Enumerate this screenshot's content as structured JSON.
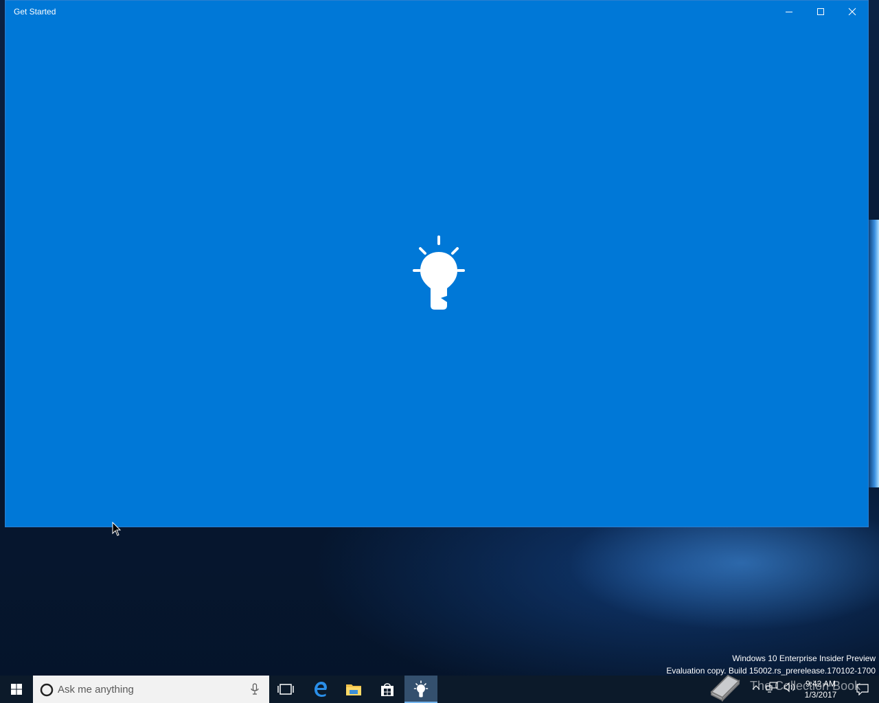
{
  "window": {
    "title": "Get Started",
    "background_color": "#0078d7",
    "splash_icon": "lightbulb-icon",
    "buttons": [
      "minimize-icon",
      "maximize-icon",
      "close-icon"
    ]
  },
  "watermark": {
    "line1": "Windows 10 Enterprise Insider Preview",
    "line2": "Evaluation copy. Build 15002.rs_prerelease.170102-1700"
  },
  "taskbar": {
    "search_placeholder": "Ask me anything",
    "pinned": [
      "task-view-icon",
      "edge-icon",
      "file-explorer-icon",
      "store-icon",
      "get-started-icon"
    ],
    "active_app": "get-started-icon",
    "overlay_text": "The Collection Book",
    "clock_time": "9:42 AM",
    "clock_date": "1/3/2017"
  }
}
